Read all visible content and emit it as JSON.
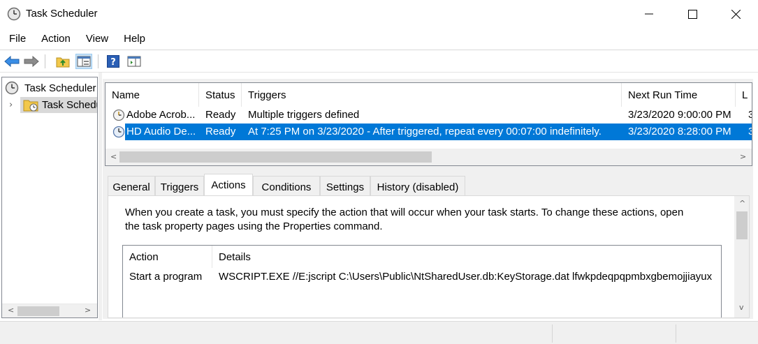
{
  "window": {
    "title": "Task Scheduler",
    "controls": {
      "minimize": "—",
      "maximize": "☐",
      "close": "✕"
    }
  },
  "menu": [
    "File",
    "Action",
    "View",
    "Help"
  ],
  "tree": {
    "root_label": "Task Scheduler",
    "child_label": "Task Schedu",
    "expander": "›"
  },
  "task_list": {
    "columns": [
      "Name",
      "Status",
      "Triggers",
      "Next Run Time",
      "L"
    ],
    "rows": [
      {
        "name": "Adobe Acrob...",
        "status": "Ready",
        "triggers": "Multiple triggers defined",
        "next_run": "3/23/2020 9:00:00 PM",
        "last": "3",
        "selected": false
      },
      {
        "name": "HD Audio De...",
        "status": "Ready",
        "triggers": "At 7:25 PM on 3/23/2020 - After triggered, repeat every 00:07:00 indefinitely.",
        "next_run": "3/23/2020 8:28:00 PM",
        "last": "3",
        "selected": true
      }
    ]
  },
  "tabs": [
    "General",
    "Triggers",
    "Actions",
    "Conditions",
    "Settings",
    "History (disabled)"
  ],
  "active_tab": "Actions",
  "actions_tab": {
    "description_line1": "When you create a task, you must specify the action that will occur when your task starts.  To change these actions, open",
    "description_line2": "the task property pages using the Properties command.",
    "columns": [
      "Action",
      "Details"
    ],
    "rows": [
      {
        "action": "Start a program",
        "details": "WSCRIPT.EXE //E:jscript C:\\Users\\Public\\NtSharedUser.db:KeyStorage.dat lfwkpdeqpqpmbxgbemojjiayux"
      }
    ]
  },
  "scroll_arrows": {
    "left": "<",
    "right": ">",
    "up": "^",
    "down": "v"
  },
  "colors": {
    "selection": "#0078d7",
    "chrome": "#f0f0f0",
    "border": "#828790"
  }
}
